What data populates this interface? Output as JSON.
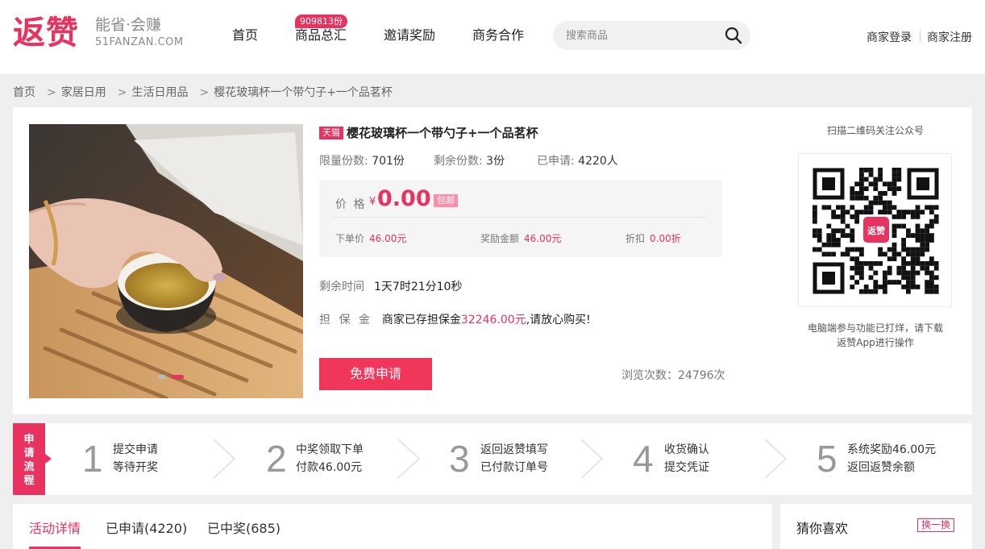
{
  "header": {
    "logo": {
      "mark": "返赞",
      "slogan": "能省·会赚",
      "domain": "51FANZAN.COM"
    },
    "nav": [
      {
        "label": "首页"
      },
      {
        "label": "商品总汇",
        "badge": "909813份"
      },
      {
        "label": "邀请奖励"
      },
      {
        "label": "商务合作"
      }
    ],
    "search": {
      "placeholder": "搜索商品"
    },
    "links": {
      "login": "商家登录",
      "register": "商家注册"
    }
  },
  "breadcrumb": [
    "首页",
    "家居日用",
    "生活日用品",
    "樱花玻璃杯一个带勺子+一个品茗杯"
  ],
  "breadcrumb_sep": ">",
  "product": {
    "tag": "天猫",
    "title": "樱花玻璃杯一个带勺子+一个品茗杯",
    "stats": {
      "limit_label": "限量份数:",
      "limit_value": "701份",
      "remain_label": "剩余份数:",
      "remain_value": "3份",
      "applied_label": "已申请:",
      "applied_value": "4220人"
    },
    "price": {
      "label": "价 格",
      "currency": "¥",
      "value": "0.00",
      "shipping": "包邮",
      "order_label": "下单价",
      "order_value": "46.00元",
      "reward_label": "奖励金额",
      "reward_value": "46.00元",
      "discount_label": "折扣",
      "discount_value": "0.00折"
    },
    "time_label": "剩余时间",
    "time_value": "1天7时21分10秒",
    "deposit_label": "担 保 金",
    "deposit_prefix": "商家已存担保金",
    "deposit_amount": "32246.00元",
    "deposit_suffix": ",请放心购买!",
    "apply_button": "免费申请",
    "views": "浏览次数：24796次",
    "carousel_active_index": 1
  },
  "qr": {
    "title": "扫描二维码关注公众号",
    "logo": "返赞",
    "note_line1": "电脑端参与功能已打烊，请下载",
    "note_line2": "返赞App进行操作"
  },
  "process": {
    "tag": [
      "申",
      "请",
      "流",
      "程"
    ],
    "steps": [
      {
        "num": "1",
        "line1": "提交申请",
        "line2": "等待开奖"
      },
      {
        "num": "2",
        "line1": "中奖领取下单",
        "line2": "付款46.00元"
      },
      {
        "num": "3",
        "line1": "返回返赞填写",
        "line2": "已付款订单号"
      },
      {
        "num": "4",
        "line1": "收货确认",
        "line2": "提交凭证"
      },
      {
        "num": "5",
        "line1": "系统奖励46.00元",
        "line2": "返回返赞余额"
      }
    ]
  },
  "tabs": [
    {
      "label": "活动详情",
      "active": true
    },
    {
      "label": "已申请(4220)",
      "active": false
    },
    {
      "label": "已中奖(685)",
      "active": false
    }
  ],
  "sidebar": {
    "title": "猜你喜欢",
    "refresh": "换一换"
  },
  "colors": {
    "accent": "#e8325f",
    "background": "#efefef"
  }
}
